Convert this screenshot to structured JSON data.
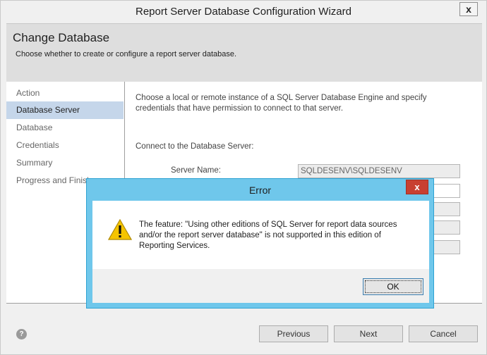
{
  "window": {
    "title": "Report Server Database Configuration Wizard",
    "close_glyph": "x"
  },
  "header": {
    "title": "Change Database",
    "subtitle": "Choose whether to create or configure a report server database."
  },
  "nav": {
    "items": [
      {
        "label": "Action",
        "active": false
      },
      {
        "label": "Database Server",
        "active": true
      },
      {
        "label": "Database",
        "active": false
      },
      {
        "label": "Credentials",
        "active": false
      },
      {
        "label": "Summary",
        "active": false
      },
      {
        "label": "Progress and Finish",
        "active": false
      }
    ]
  },
  "content": {
    "description": "Choose a local or remote instance of a SQL Server Database Engine and specify credentials that have permission to connect to that server.",
    "connect_label": "Connect to the Database Server:",
    "server_name_label": "Server Name:",
    "server_name_value": "SQLDESENV\\SQLDESENV"
  },
  "footer": {
    "help_glyph": "?",
    "previous": "Previous",
    "next": "Next",
    "cancel": "Cancel"
  },
  "error_dialog": {
    "title": "Error",
    "close_glyph": "x",
    "message": "The feature: \"Using other editions of SQL Server for report data sources and/or the report server database\" is not supported in this edition of Reporting Services.",
    "ok": "OK",
    "icon": "warning-icon"
  },
  "colors": {
    "dialog_frame": "#6fc7eb",
    "close_red": "#c84031",
    "nav_selected": "#c5d6ea",
    "warning_yellow": "#f5c400"
  }
}
